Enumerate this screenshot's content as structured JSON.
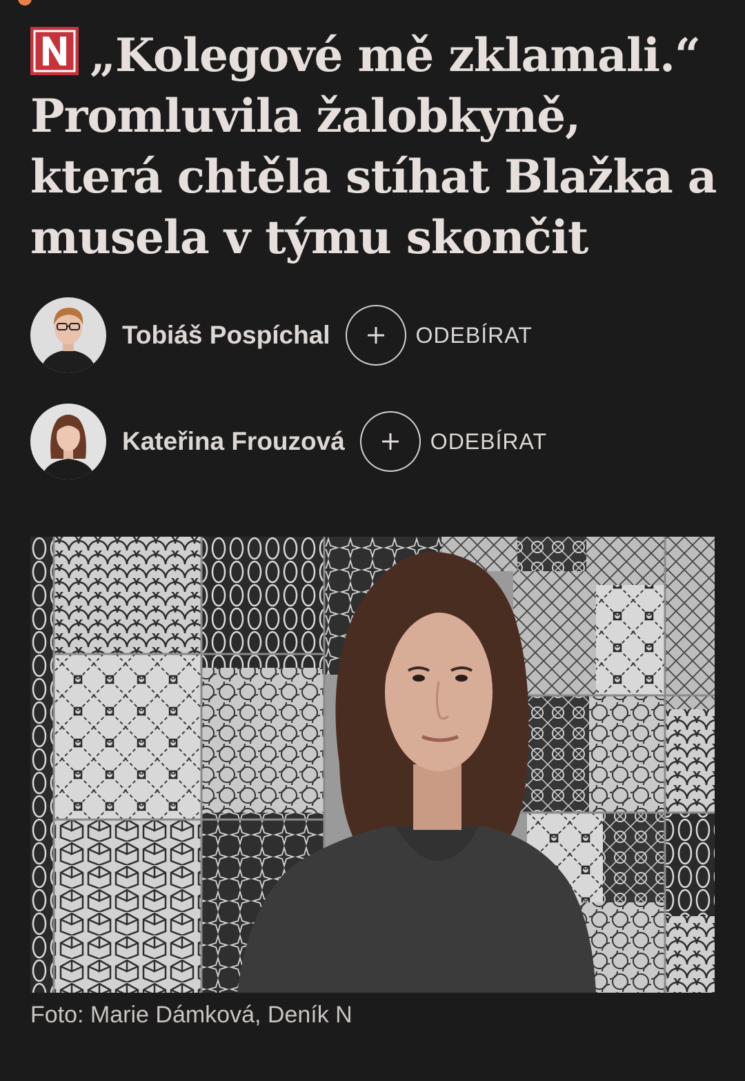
{
  "article": {
    "brand_logo_letter": "N",
    "headline": "„Kolegové mě zklamali.“ Promluvila žalobkyně, která chtěla stíhat Blažka a musela v týmu skončit"
  },
  "authors": [
    {
      "name": "Tobiáš Pospíchal",
      "follow_label": "ODEBÍRAT"
    },
    {
      "name": "Kateřina Frouzová",
      "follow_label": "ODEBÍRAT"
    }
  ],
  "photo": {
    "caption": "Foto: Marie Dámková, Deník N"
  },
  "colors": {
    "background": "#1b1b1b",
    "brand_red": "#c8323b",
    "text": "#e6dfdc"
  }
}
